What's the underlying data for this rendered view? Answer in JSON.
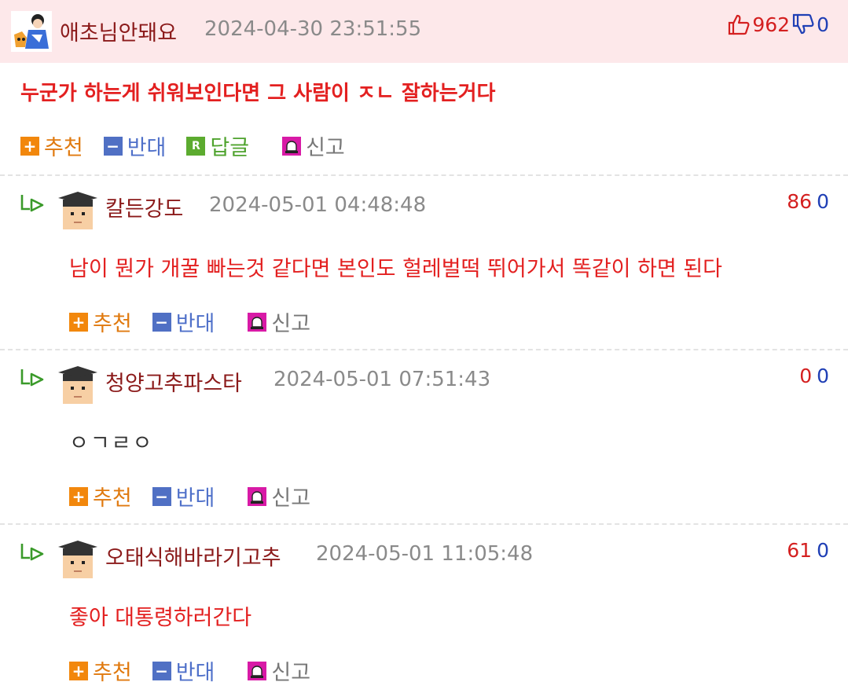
{
  "top_comment": {
    "nickname": "애초님안돼요",
    "date": "2024-04-30 23:51:55",
    "upvotes": "962",
    "downvotes": "0",
    "body": "누군가 하는게 쉬워보인다면 그 사람이 ㅈㄴ 잘하는거다",
    "actions": {
      "recommend_icon": "+",
      "recommend": "추천",
      "oppose_icon": "−",
      "oppose": "반대",
      "reply_icon": "R",
      "reply": "답글",
      "report": "신고"
    }
  },
  "replies": [
    {
      "nickname": "칼든강도",
      "date": "2024-05-01 04:48:48",
      "upvotes": "86",
      "downvotes": "0",
      "body": "남이 뭔가 개꿀 빠는것 같다면 본인도 헐레벌떡 뛰어가서 똑같이 하면 된다",
      "actions": {
        "recommend_icon": "+",
        "recommend": "추천",
        "oppose_icon": "−",
        "oppose": "반대",
        "report": "신고"
      }
    },
    {
      "nickname": "청양고추파스타",
      "date": "2024-05-01 07:51:43",
      "upvotes": "0",
      "downvotes": "0",
      "body": "ㅇㄱㄹㅇ",
      "actions": {
        "recommend_icon": "+",
        "recommend": "추천",
        "oppose_icon": "−",
        "oppose": "반대",
        "report": "신고"
      }
    },
    {
      "nickname": "오태식해바라기고추",
      "date": "2024-05-01 11:05:48",
      "upvotes": "61",
      "downvotes": "0",
      "body": "좋아 대통령하러간다",
      "actions": {
        "recommend_icon": "+",
        "recommend": "추천",
        "oppose_icon": "−",
        "oppose": "반대",
        "report": "신고"
      }
    }
  ],
  "icons": {
    "thumbs_up": "thumbs-up-icon",
    "thumbs_down": "thumbs-down-icon",
    "reply_arrow": "reply-arrow-icon",
    "report": "siren-icon",
    "avatar_default": "graduate-avatar-icon"
  },
  "colors": {
    "top_header_bg": "#fde8ea",
    "nickname": "#8b1a1a",
    "body_red": "#e32020",
    "upvote": "#d42020",
    "downvote": "#1f3fb5",
    "recommend": "#f2870c",
    "oppose": "#5070c4",
    "reply": "#5cab2f",
    "report": "#d81aa6"
  }
}
